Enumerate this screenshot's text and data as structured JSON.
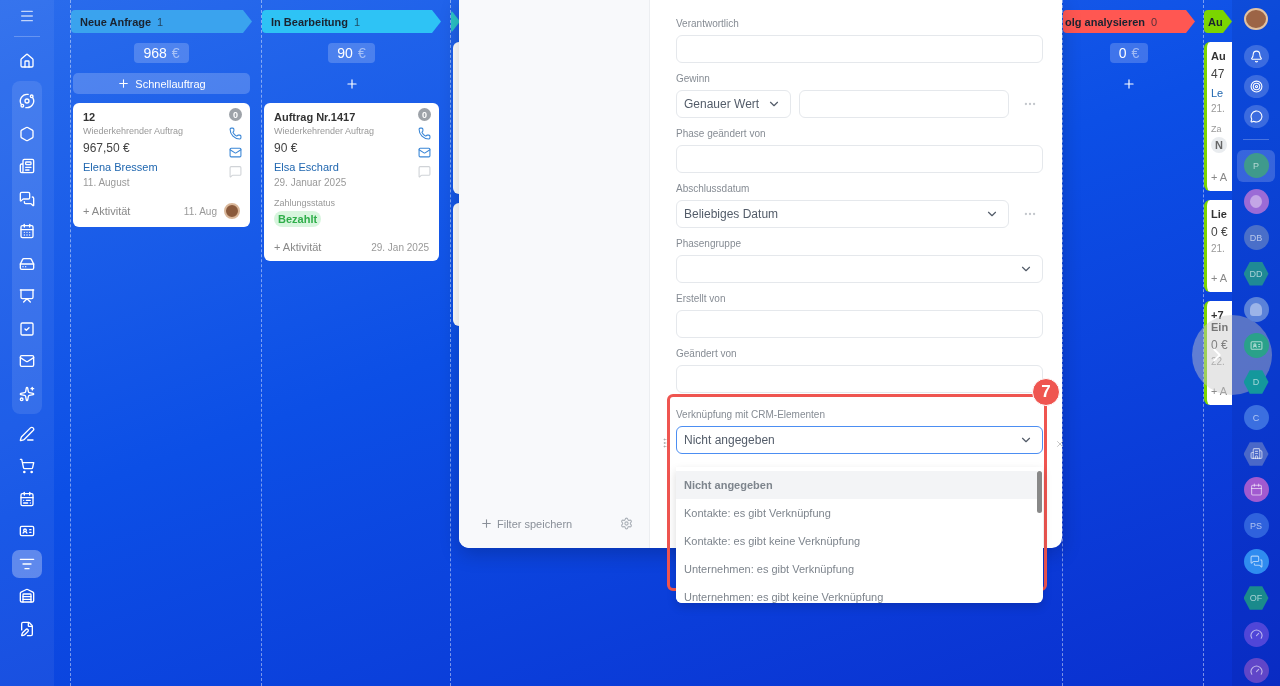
{
  "left_sidebar": {
    "groups": [
      {
        "boxed": false,
        "items": [
          {
            "selected": false
          }
        ]
      },
      {
        "boxed": true,
        "items": [
          {
            "selected": false
          },
          {
            "selected": false
          },
          {
            "selected": false
          },
          {
            "selected": false
          },
          {
            "selected": false
          },
          {
            "selected": false
          },
          {
            "selected": false
          },
          {
            "selected": false
          },
          {
            "selected": false
          },
          {
            "selected": false
          }
        ]
      },
      {
        "boxed": false,
        "items": [
          {
            "selected": false
          },
          {
            "selected": false
          },
          {
            "selected": false
          },
          {
            "selected": false
          },
          {
            "selected": true
          },
          {
            "selected": false
          },
          {
            "selected": false
          }
        ]
      }
    ]
  },
  "columns": [
    {
      "title": "Neue Anfrage",
      "count": "1",
      "color": "#3aa3ee",
      "sum": "968",
      "currency": "€",
      "add": {
        "kind": "quick",
        "label": "Schnellauftrag"
      },
      "cards": [
        {
          "title": "12",
          "subtitle": "Wiederkehrender Auftrag",
          "amount": "967,50 €",
          "contact": "Elena Bressem",
          "date": "11. August",
          "counter": "0",
          "activity": "+ Aktivität",
          "footer_date": "11. Aug",
          "avatar": true
        }
      ]
    },
    {
      "title": "In Bearbeitung",
      "count": "1",
      "color": "#2ec3f5",
      "sum": "90",
      "currency": "€",
      "add": {
        "kind": "plus"
      },
      "cards": [
        {
          "title": "Auftrag Nr.1417",
          "subtitle": "Wiederkehrender Auftrag",
          "amount": "90 €",
          "contact": "Elsa Eschard",
          "date": "29. Januar 2025",
          "counter": "0",
          "payment_label": "Zahlungsstatus",
          "payment_status": "Bezahlt",
          "activity": "+ Aktivität",
          "footer_date": "29. Jan 2025",
          "avatar": false
        }
      ]
    },
    {
      "color": "#2bc4c6",
      "cards": [
        {
          "kind": "edge"
        },
        {
          "kind": "edge"
        }
      ]
    }
  ],
  "right_columns": [
    {
      "title": "olg analysieren",
      "count": "0",
      "color": "#ff5752",
      "sum": "0",
      "currency": "€",
      "add": {
        "kind": "plus"
      }
    },
    {
      "title": "Au",
      "color": "#7bd500",
      "cards": [
        {
          "lines": [
            {
              "kind": "title",
              "text": "Au"
            },
            {
              "kind": "amount",
              "text": "47"
            },
            {
              "kind": "link",
              "text": "Le"
            },
            {
              "kind": "muted",
              "text": "21."
            },
            {
              "kind": "small",
              "text": "Za"
            },
            {
              "kind": "tag",
              "text": "N"
            },
            {
              "kind": "activity",
              "text": "+ A"
            }
          ]
        },
        {
          "lines": [
            {
              "kind": "title",
              "text": "Lie"
            },
            {
              "kind": "amount",
              "text": "0 €"
            },
            {
              "kind": "muted",
              "text": "21."
            },
            {
              "kind": "activity",
              "text": "+ A"
            }
          ]
        },
        {
          "lines": [
            {
              "kind": "title",
              "text": "+7"
            },
            {
              "kind": "title",
              "text": "Ein"
            },
            {
              "kind": "amount",
              "text": "0 €"
            },
            {
              "kind": "muted",
              "text": "22."
            },
            {
              "kind": "activity",
              "text": "+ A"
            }
          ]
        }
      ]
    }
  ],
  "filter_panel": {
    "save_label": "Filter speichern",
    "fields": [
      {
        "kind": "input",
        "label": "Verantwortlich"
      },
      {
        "kind": "range",
        "label": "Gewinn",
        "value": "Genauer Wert"
      },
      {
        "kind": "input",
        "label": "Phase geändert von"
      },
      {
        "kind": "date",
        "label": "Abschlussdatum",
        "value": "Beliebiges Datum"
      },
      {
        "kind": "select",
        "label": "Phasengruppe"
      },
      {
        "kind": "input",
        "label": "Erstellt von"
      },
      {
        "kind": "input",
        "label": "Geändert von"
      }
    ],
    "crm_link": {
      "label": "Verknüpfung mit CRM-Elementen",
      "value": "Nicht angegeben",
      "expanded": true,
      "badge": "7",
      "options": [
        {
          "label": "Nicht angegeben",
          "selected": true
        },
        {
          "label": "Kontakte: es gibt Verknüpfung",
          "selected": false
        },
        {
          "label": "Kontakte: es gibt keine Verknüpfung",
          "selected": false
        },
        {
          "label": "Unternehmen: es gibt Verknüpfung",
          "selected": false
        },
        {
          "label": "Unternehmen: es gibt keine Verknüpfung",
          "selected": false
        }
      ]
    }
  },
  "right_sidebar": {
    "contacts": [
      {
        "kind": "initials",
        "text": "P",
        "color": "#3f9a8c",
        "selected": true
      },
      {
        "kind": "alert",
        "color": "#9b6bd6",
        "selected": false
      },
      {
        "kind": "initials",
        "text": "DB",
        "color": "#4a6fc9",
        "selected": false
      },
      {
        "kind": "hex",
        "text": "DD",
        "color": "#1f8a95",
        "selected": false
      },
      {
        "kind": "photo",
        "color": "#5b82d9",
        "selected": false
      },
      {
        "kind": "card",
        "color": "#2aa18a",
        "selected": false
      },
      {
        "kind": "hex",
        "text": "D",
        "color": "#14989c",
        "selected": false
      },
      {
        "kind": "initials",
        "text": "C",
        "color": "#3b6fe0",
        "selected": false
      },
      {
        "kind": "building",
        "color": "#4a68c8",
        "selected": false
      },
      {
        "kind": "calendar",
        "color": "#a15ad0",
        "selected": false
      },
      {
        "kind": "initials",
        "text": "PS",
        "color": "#2f62dd",
        "selected": false
      },
      {
        "kind": "chat",
        "color": "#2f8cf0",
        "selected": false
      },
      {
        "kind": "hex",
        "text": "OF",
        "color": "#1a8a8c",
        "selected": false
      },
      {
        "kind": "gauge",
        "color": "#5046d8",
        "selected": false
      },
      {
        "kind": "gauge",
        "color": "#6046c8",
        "selected": false
      }
    ]
  }
}
